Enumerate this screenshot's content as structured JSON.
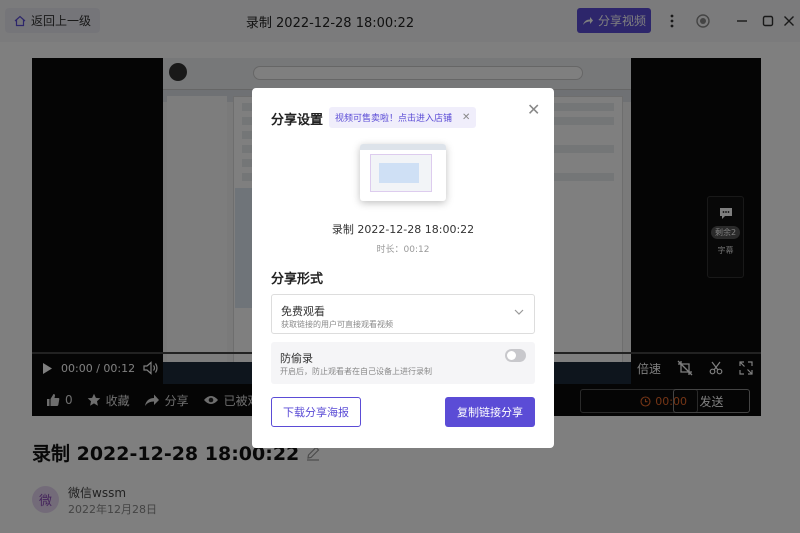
{
  "header": {
    "back_label": "返回上一级",
    "title": "录制 2022-12-28 18:00:22",
    "share_video_label": "分享视频"
  },
  "player": {
    "time": "00:00 / 00:12",
    "speed_label": "倍速",
    "side_panel": {
      "badge": "剩余2",
      "label": "字幕"
    },
    "actions": {
      "like_count": "0",
      "collect_label": "收藏",
      "share_label": "分享",
      "watched_label": "已被观"
    },
    "timer": "00:00",
    "send_label": "发送"
  },
  "page": {
    "recording_title": "录制 2022-12-28 18:00:22",
    "user_avatar_char": "微",
    "user_name": "微信wssm",
    "user_date": "2022年12月28日"
  },
  "dialog": {
    "title": "分享设置",
    "promo_text": "视频可售卖啦！点击进入店铺",
    "recording_name": "录制 2022-12-28 18:00:22",
    "duration": "时长：00:12",
    "share_form_title": "分享形式",
    "select_value": "免费观看",
    "select_desc": "获取链接的用户可直接观看视频",
    "anti_record_label": "防偷录",
    "anti_record_desc": "开启后，防止观看者在自己设备上进行录制",
    "anti_record_enabled": false,
    "download_poster_label": "下载分享海报",
    "copy_link_label": "复制链接分享"
  },
  "colors": {
    "accent": "#5b4cd6",
    "timer": "#e86a2c"
  }
}
